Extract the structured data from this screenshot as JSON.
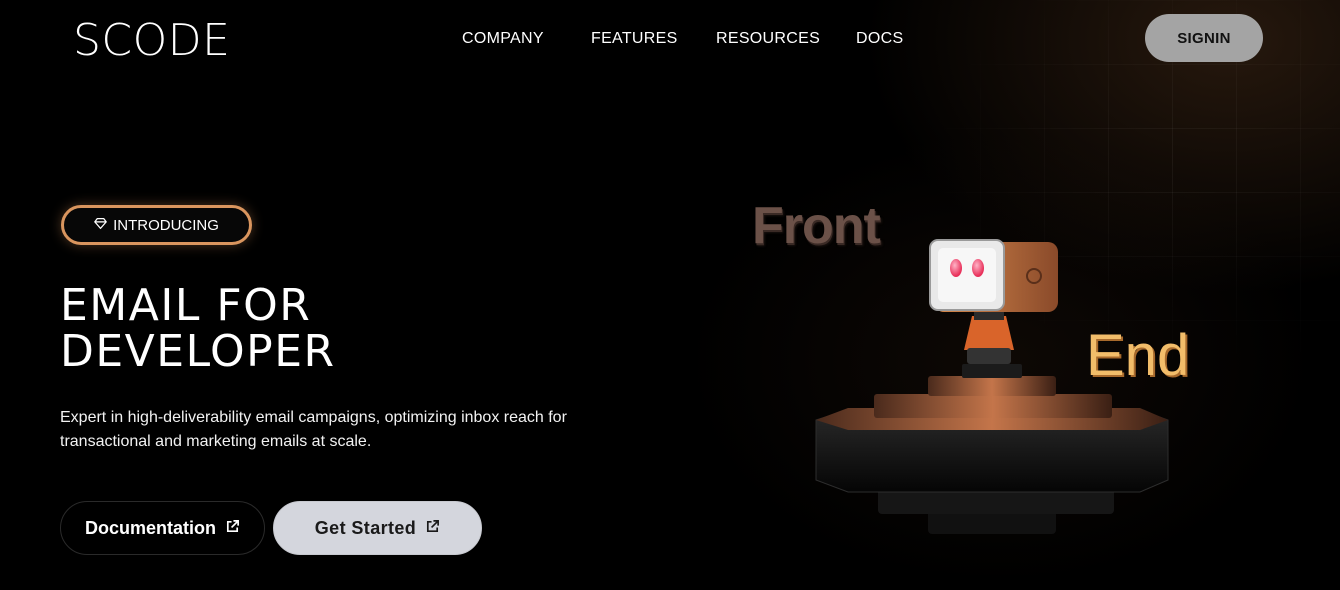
{
  "brand": {
    "logo_text": "SCODE"
  },
  "nav": {
    "items": [
      {
        "label": "COMPANY"
      },
      {
        "label": "FEATURES"
      },
      {
        "label": "RESOURCES"
      },
      {
        "label": "DOCS"
      }
    ],
    "signin_label": "SIGNIN"
  },
  "hero": {
    "badge_label": "INTRODUCING",
    "headline_line1": "EMAIL FOR",
    "headline_line2": "DEVELOPER",
    "description": "Expert in high-deliverability email campaigns, optimizing inbox reach for transactional and marketing emails at scale.",
    "primary_cta": "Documentation",
    "secondary_cta": "Get Started"
  },
  "illustration": {
    "word_left": "Front",
    "word_right": "End"
  },
  "icons": {
    "badge": "diamond-icon",
    "cta": "external-link-icon"
  },
  "colors": {
    "background": "#000000",
    "signin_bg": "#a4a4a4",
    "badge_border": "#d9955e",
    "get_started_bg": "#d4d6dd",
    "end_text": "#f2bd6a",
    "front_text": "#6b5148"
  }
}
